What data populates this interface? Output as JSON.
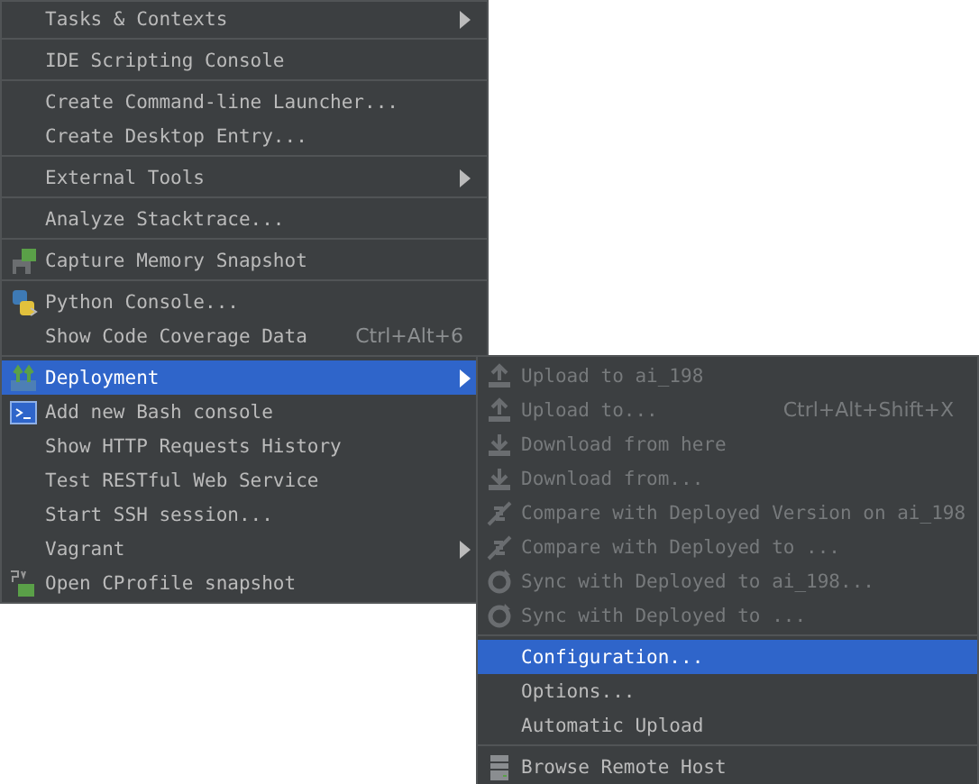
{
  "menu": {
    "items": [
      {
        "kind": "item",
        "label": "Tasks & Contexts",
        "submenu": true,
        "selected": false
      },
      {
        "kind": "separator"
      },
      {
        "kind": "item",
        "label": "IDE Scripting Console",
        "selected": false
      },
      {
        "kind": "separator"
      },
      {
        "kind": "item",
        "label": "Create Command-line Launcher...",
        "selected": false
      },
      {
        "kind": "item",
        "label": "Create Desktop Entry...",
        "selected": false
      },
      {
        "kind": "separator"
      },
      {
        "kind": "item",
        "label": "External Tools",
        "submenu": true,
        "selected": false
      },
      {
        "kind": "separator"
      },
      {
        "kind": "item",
        "label": "Analyze Stacktrace...",
        "selected": false
      },
      {
        "kind": "separator"
      },
      {
        "kind": "item",
        "label": "Capture Memory Snapshot",
        "selected": false
      },
      {
        "kind": "separator"
      },
      {
        "kind": "item",
        "label": "Python Console...",
        "selected": false
      },
      {
        "kind": "item",
        "label": "Show Code Coverage Data",
        "shortcut": "Ctrl+Alt+6",
        "selected": false
      },
      {
        "kind": "separator"
      },
      {
        "kind": "item",
        "label": "Deployment",
        "submenu": true,
        "selected": true,
        "expanded": true,
        "children": [
          {
            "kind": "item",
            "label": "Upload to ai_198",
            "disabled": true,
            "selected": false
          },
          {
            "kind": "item",
            "label": "Upload to...",
            "shortcut": "Ctrl+Alt+Shift+X",
            "disabled": true,
            "selected": false
          },
          {
            "kind": "item",
            "label": "Download from here",
            "disabled": true,
            "selected": false
          },
          {
            "kind": "item",
            "label": "Download from...",
            "disabled": true,
            "selected": false
          },
          {
            "kind": "item",
            "label": "Compare with Deployed Version on ai_198",
            "disabled": true,
            "selected": false
          },
          {
            "kind": "item",
            "label": "Compare with Deployed to ...",
            "disabled": true,
            "selected": false
          },
          {
            "kind": "item",
            "label": "Sync with Deployed to ai_198...",
            "disabled": true,
            "selected": false
          },
          {
            "kind": "item",
            "label": "Sync with Deployed to ...",
            "disabled": true,
            "selected": false
          },
          {
            "kind": "separator"
          },
          {
            "kind": "item",
            "label": "Configuration...",
            "disabled": false,
            "selected": true
          },
          {
            "kind": "item",
            "label": "Options...",
            "disabled": false,
            "selected": false
          },
          {
            "kind": "item",
            "label": "Automatic Upload",
            "disabled": false,
            "selected": false
          },
          {
            "kind": "separator"
          },
          {
            "kind": "item",
            "label": "Browse Remote Host",
            "disabled": false,
            "selected": false
          }
        ]
      },
      {
        "kind": "item",
        "label": "Add new Bash console",
        "selected": false
      },
      {
        "kind": "item",
        "label": "Show HTTP Requests History",
        "selected": false
      },
      {
        "kind": "item",
        "label": "Test RESTful Web Service",
        "selected": false
      },
      {
        "kind": "item",
        "label": "Start SSH session...",
        "selected": false
      },
      {
        "kind": "item",
        "label": "Vagrant",
        "submenu": true,
        "selected": false
      },
      {
        "kind": "item",
        "label": "Open CProfile snapshot",
        "selected": false
      }
    ]
  }
}
